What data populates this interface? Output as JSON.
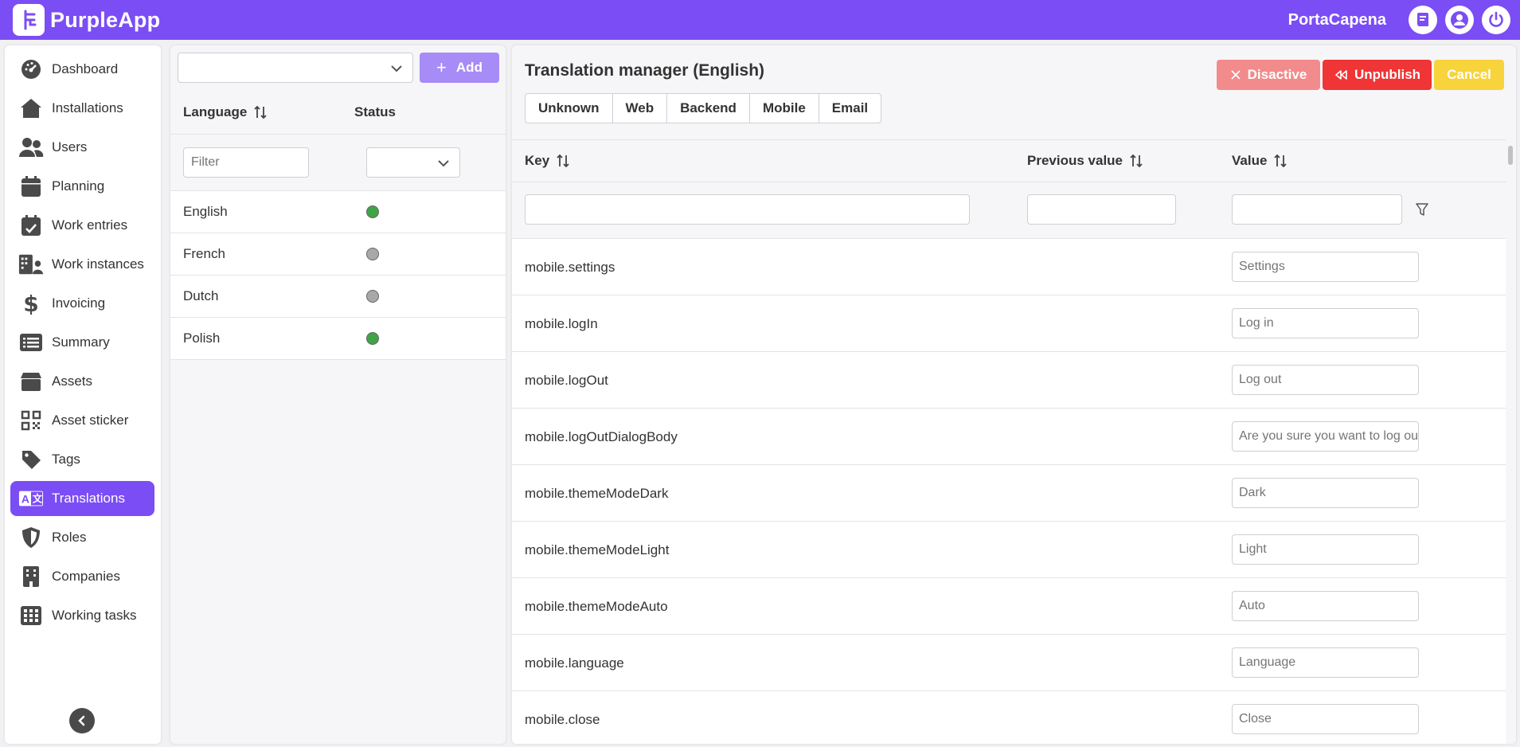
{
  "app": {
    "name": "PurpleApp",
    "tenant": "PortaCapena"
  },
  "colors": {
    "brand": "#7b4df5",
    "active": "#3fa447",
    "inactive": "#a8a8a8",
    "danger_light": "#f28b8b",
    "danger": "#ef3535",
    "warning": "#f7d33c"
  },
  "sidebar": {
    "items": [
      {
        "label": "Dashboard",
        "icon": "dashboard-icon"
      },
      {
        "label": "Installations",
        "icon": "house-icon"
      },
      {
        "label": "Users",
        "icon": "users-icon"
      },
      {
        "label": "Planning",
        "icon": "calendar-icon"
      },
      {
        "label": "Work entries",
        "icon": "calendar-check-icon"
      },
      {
        "label": "Work instances",
        "icon": "building-user-icon"
      },
      {
        "label": "Invoicing",
        "icon": "dollar-icon"
      },
      {
        "label": "Summary",
        "icon": "list-icon"
      },
      {
        "label": "Assets",
        "icon": "box-icon"
      },
      {
        "label": "Asset sticker",
        "icon": "qrcode-icon"
      },
      {
        "label": "Tags",
        "icon": "tag-icon"
      },
      {
        "label": "Translations",
        "icon": "language-icon",
        "active": true
      },
      {
        "label": "Roles",
        "icon": "shield-icon"
      },
      {
        "label": "Companies",
        "icon": "building-icon"
      },
      {
        "label": "Working tasks",
        "icon": "grid-icon"
      }
    ]
  },
  "languages": {
    "add_label": "Add",
    "col_language": "Language",
    "col_status": "Status",
    "filter_placeholder": "Filter",
    "rows": [
      {
        "name": "English",
        "status": "active"
      },
      {
        "name": "French",
        "status": "inactive"
      },
      {
        "name": "Dutch",
        "status": "inactive"
      },
      {
        "name": "Polish",
        "status": "active"
      }
    ]
  },
  "manager": {
    "title": "Translation manager (English)",
    "tabs": [
      "Unknown",
      "Web",
      "Backend",
      "Mobile",
      "Email"
    ],
    "buttons": {
      "disactive": "Disactive",
      "unpublish": "Unpublish",
      "cancel": "Cancel"
    },
    "columns": {
      "key": "Key",
      "previous": "Previous value",
      "value": "Value"
    },
    "rows": [
      {
        "key": "mobile.settings",
        "value": "Settings"
      },
      {
        "key": "mobile.logIn",
        "value": "Log in"
      },
      {
        "key": "mobile.logOut",
        "value": "Log out"
      },
      {
        "key": "mobile.logOutDialogBody",
        "value": "Are you sure you want to log out?"
      },
      {
        "key": "mobile.themeModeDark",
        "value": "Dark"
      },
      {
        "key": "mobile.themeModeLight",
        "value": "Light"
      },
      {
        "key": "mobile.themeModeAuto",
        "value": "Auto"
      },
      {
        "key": "mobile.language",
        "value": "Language"
      },
      {
        "key": "mobile.close",
        "value": "Close"
      }
    ]
  }
}
